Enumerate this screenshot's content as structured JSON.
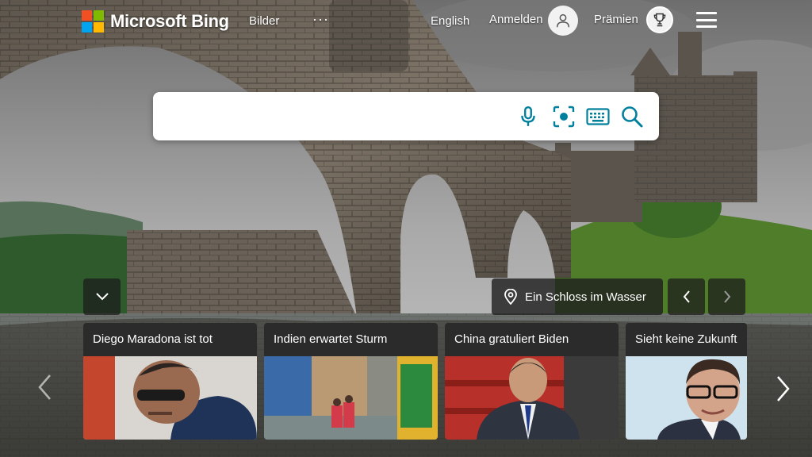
{
  "header": {
    "brand": "Microsoft Bing",
    "images_link": "Bilder",
    "more": "···",
    "language": "English",
    "sign_in": "Anmelden",
    "rewards": "Prämien"
  },
  "search": {
    "value": "",
    "placeholder": ""
  },
  "image_of_day": {
    "location_label": "Ein Schloss im Wasser"
  },
  "news": [
    {
      "title": "Diego Maradona ist tot"
    },
    {
      "title": "Indien erwartet Sturm"
    },
    {
      "title": "China gratuliert Biden"
    },
    {
      "title": "Sieht keine Zukunft"
    }
  ],
  "colors": {
    "ms_red": "#f25022",
    "ms_green": "#7fba00",
    "ms_blue": "#00a4ef",
    "ms_yellow": "#ffb900",
    "search_icon_teal": "#00809d"
  },
  "icons": [
    "microphone-icon",
    "visual-search-icon",
    "keyboard-icon",
    "search-icon",
    "user-icon",
    "trophy-icon",
    "hamburger-icon",
    "location-pin-icon",
    "chevron-left-icon",
    "chevron-right-icon",
    "chevron-down-icon"
  ]
}
